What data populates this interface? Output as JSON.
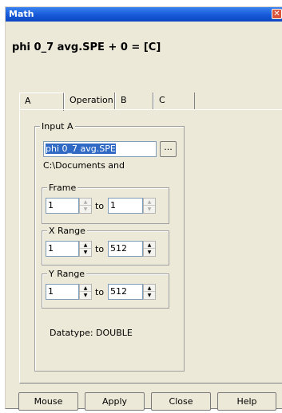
{
  "window": {
    "title": "Math",
    "close_glyph": "✕"
  },
  "formula": "phi 0_7 avg.SPE + 0 = [C]",
  "tabs": [
    {
      "label": "A"
    },
    {
      "label": "Operation"
    },
    {
      "label": "B"
    },
    {
      "label": "C"
    }
  ],
  "input_a": {
    "group_label": "Input A",
    "file_value": "phi 0_7 avg.SPE",
    "browse_label": "...",
    "path": "C:\\Documents and",
    "frame": {
      "label": "Frame",
      "from": "1",
      "to_label": "to",
      "to": "1"
    },
    "x_range": {
      "label": "X Range",
      "from": "1",
      "to_label": "to",
      "to": "512"
    },
    "y_range": {
      "label": "Y Range",
      "from": "1",
      "to_label": "to",
      "to": "512"
    },
    "datatype": "Datatype:  DOUBLE"
  },
  "buttons": {
    "mouse": "Mouse",
    "apply": "Apply",
    "close": "Close",
    "help": "Help"
  },
  "colors": {
    "titlebar": "#1659d8",
    "selection": "#316ac5",
    "dialog_bg": "#ece9d8"
  }
}
